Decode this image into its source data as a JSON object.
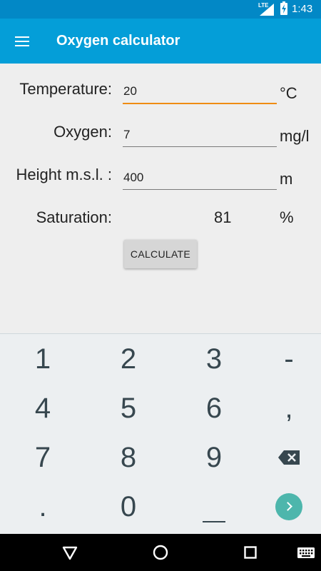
{
  "status_bar": {
    "network": "LTE",
    "time": "1:43",
    "icons": [
      "signal-icon",
      "battery-charging-icon"
    ]
  },
  "app_bar": {
    "title": "Oxygen calculator",
    "menu_icon": "hamburger-menu-icon"
  },
  "form": {
    "temperature": {
      "label": "Temperature:",
      "value": "20",
      "unit": "°C"
    },
    "oxygen": {
      "label": "Oxygen:",
      "value": "7",
      "unit": "mg/l"
    },
    "height": {
      "label": "Height m.s.l. :",
      "value": "400",
      "unit": "m"
    },
    "saturation": {
      "label": "Saturation:",
      "value": "81",
      "unit": "%"
    },
    "calculate_label": "CALCULATE"
  },
  "keyboard": {
    "row1": [
      "1",
      "2",
      "3",
      "-"
    ],
    "row2": [
      "4",
      "5",
      "6",
      ","
    ],
    "row3": [
      "7",
      "8",
      "9"
    ],
    "row4": [
      ".",
      "0"
    ],
    "icons": [
      "backspace-icon",
      "space-icon",
      "go-icon"
    ]
  },
  "nav_bar": {
    "icons": [
      "back-icon",
      "home-icon",
      "recents-icon",
      "keyboard-switch-icon"
    ]
  },
  "colors": {
    "status_bar": "#0288c6",
    "app_bar": "#049ed8",
    "accent": "#ef8c12",
    "go_key": "#4db6ac"
  }
}
